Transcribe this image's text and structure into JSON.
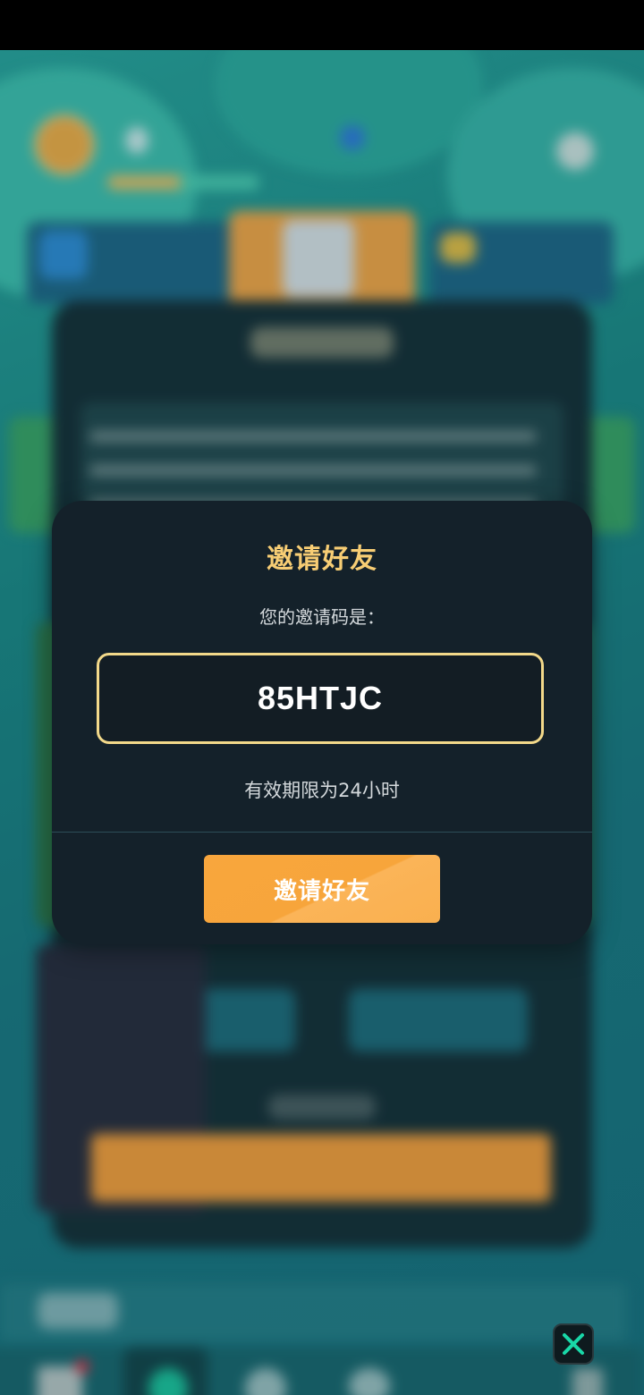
{
  "dialog": {
    "title": "邀请好友",
    "subtitle": "您的邀请码是：",
    "invite_code": "85HTJC",
    "validity_note": "有效期限为24小时",
    "invite_button_label": "邀请好友"
  },
  "icons": {
    "close": "close-icon"
  },
  "colors": {
    "title": "#f7cd74",
    "code_border": "#f3d98a",
    "button": "#f8a63d",
    "modal_bg": "#14212a",
    "close_icon": "#19d8a8"
  }
}
